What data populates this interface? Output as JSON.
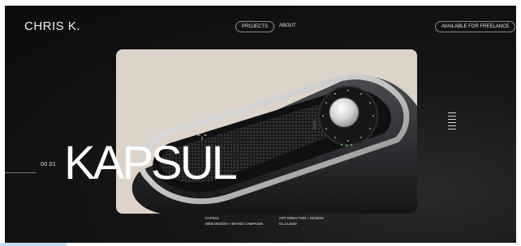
{
  "header": {
    "logo": "CHRIS K.",
    "nav": {
      "projects": "PROJECTS",
      "about": "ABOUT"
    },
    "cta": "AVAILABLE FOR FREELANCE"
  },
  "hero": {
    "index": "00.01",
    "title": "KAPSUL"
  },
  "project_meta": {
    "name": "KAPSUL",
    "category": "WEB DESIGN + BRAND CAMPAIGN",
    "role": "ART DIRECTION + DESIGN",
    "date": "04.14.2020"
  },
  "colors": {
    "background": "#111111",
    "card_background": "#ddd3c8",
    "text": "#ffffff"
  },
  "icons": {
    "cursor": "crosshair-icon",
    "scroll": "scroll-indicator-icon"
  }
}
